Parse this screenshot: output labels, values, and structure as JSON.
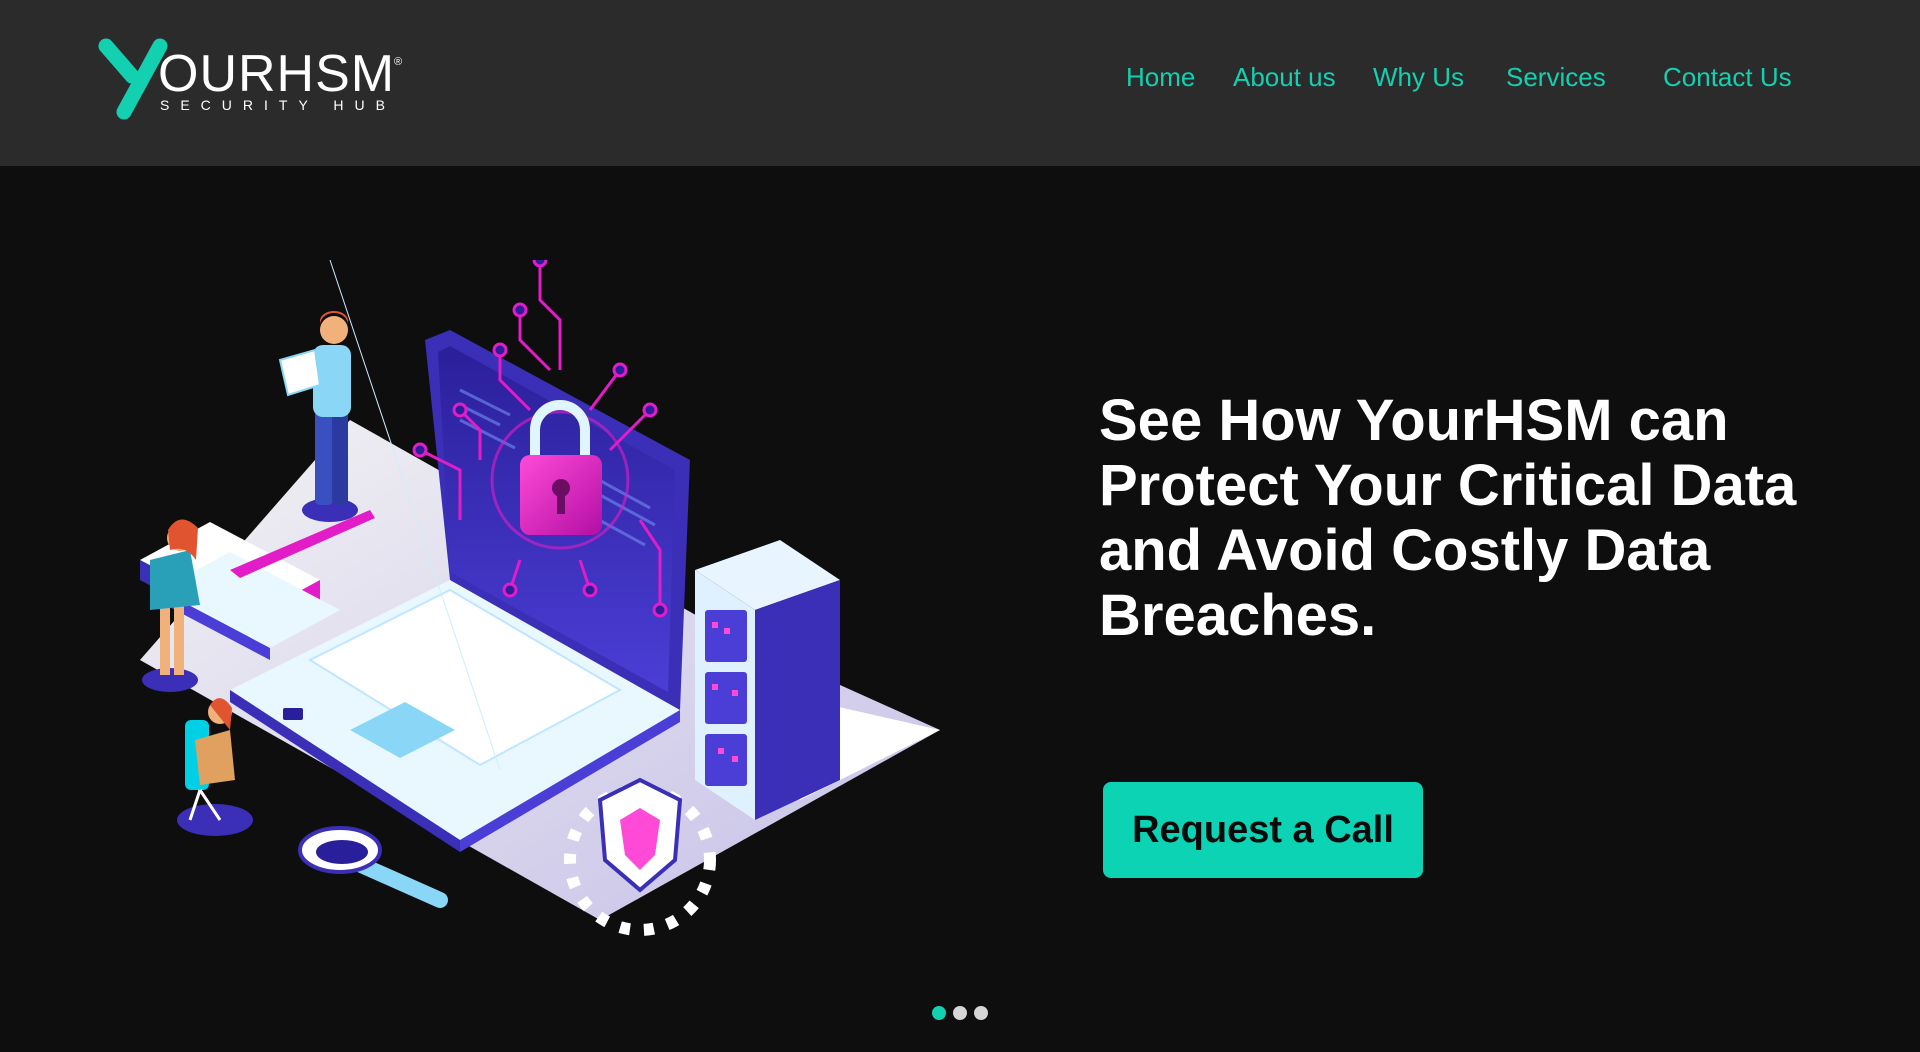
{
  "header": {
    "logo": {
      "wordmark": "OURHSM",
      "tagline": "SECURITY HUB",
      "registered": "®"
    },
    "nav": [
      {
        "label": "Home"
      },
      {
        "label": "About us"
      },
      {
        "label": "Why Us"
      },
      {
        "label": "Services"
      },
      {
        "label": "Contact Us"
      }
    ]
  },
  "hero": {
    "headline": "See How YourHSM can Protect Your Critical Data and Avoid Costly Data Breaches.",
    "cta_label": "Request a Call",
    "illustration": "isometric-cybersecurity-laptop-illustration"
  },
  "carousel": {
    "slides": 3,
    "active_index": 0
  },
  "colors": {
    "accent": "#13d0b0",
    "header_bg": "#2b2b2c",
    "page_bg": "#0e0e0f",
    "magenta": "#e21cc6",
    "indigo": "#3a2fb6"
  }
}
